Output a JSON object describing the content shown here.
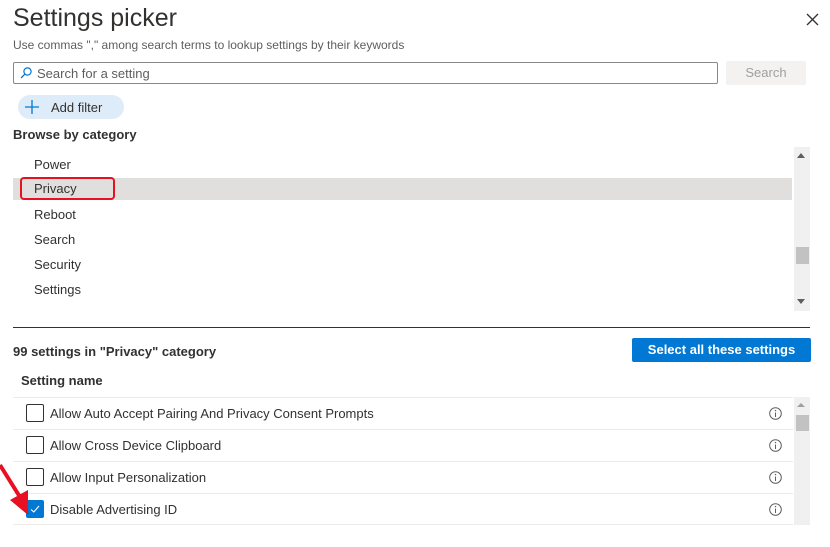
{
  "header": {
    "title": "Settings picker",
    "subtitle": "Use commas \",\" among search terms to lookup settings by their keywords"
  },
  "search": {
    "placeholder": "Search for a setting",
    "value": "",
    "button_label": "Search"
  },
  "filter": {
    "add_label": "Add filter"
  },
  "browse": {
    "label": "Browse by category",
    "categories": [
      {
        "label": "Power",
        "selected": false
      },
      {
        "label": "Privacy",
        "selected": true
      },
      {
        "label": "Reboot",
        "selected": false
      },
      {
        "label": "Search",
        "selected": false
      },
      {
        "label": "Security",
        "selected": false
      },
      {
        "label": "Settings",
        "selected": false
      }
    ]
  },
  "results": {
    "count_label": "99 settings in \"Privacy\" category",
    "select_all_label": "Select all these settings",
    "column_header": "Setting name",
    "rows": [
      {
        "name": "Allow Auto Accept Pairing And Privacy Consent Prompts",
        "checked": false
      },
      {
        "name": "Allow Cross Device Clipboard",
        "checked": false
      },
      {
        "name": "Allow Input Personalization",
        "checked": false
      },
      {
        "name": "Disable Advertising ID",
        "checked": true
      }
    ]
  },
  "colors": {
    "accent": "#0078d4",
    "selected_row": "#e1dfdd",
    "highlight": "#e81123",
    "annotation_arrow": "#e81123"
  },
  "icons": {
    "close": "close-icon",
    "search": "search-icon",
    "add": "plus-icon",
    "info": "info-icon",
    "check": "checkmark-icon"
  }
}
